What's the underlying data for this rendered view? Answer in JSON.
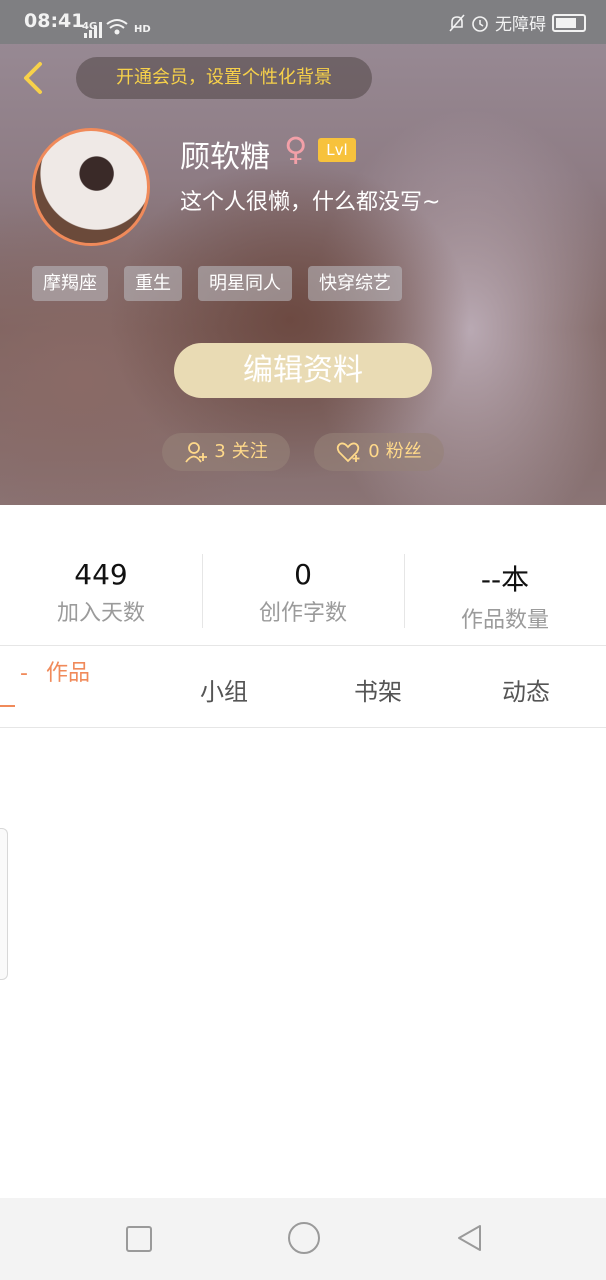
{
  "status_bar": {
    "time": "08:41",
    "network": "4G",
    "hd": "HD",
    "accessibility": "无障碍"
  },
  "header": {
    "vip_prompt": "开通会员，设置个性化背景",
    "username": "顾软糖",
    "level": "Lvl",
    "bio": "这个人很懒，什么都没写~",
    "tags": [
      "摩羯座",
      "重生",
      "明星同人",
      "快穿综艺"
    ],
    "edit_button": "编辑资料",
    "following": {
      "count": "3",
      "label": "关注"
    },
    "fans": {
      "count": "0",
      "label": "粉丝"
    }
  },
  "stats": [
    {
      "value": "449",
      "label": "加入天数"
    },
    {
      "value": "0",
      "label": "创作字数"
    },
    {
      "value": "--本",
      "label": "作品数量"
    }
  ],
  "tabs": {
    "works": "作品",
    "groups": "小组",
    "bookshelf": "书架",
    "activity": "动态"
  },
  "colors": {
    "accent_orange": "#f08a5a",
    "vip_yellow": "#f7d14a",
    "edit_button_bg": "#e9dbb4",
    "level_badge": "#f7c23c"
  }
}
